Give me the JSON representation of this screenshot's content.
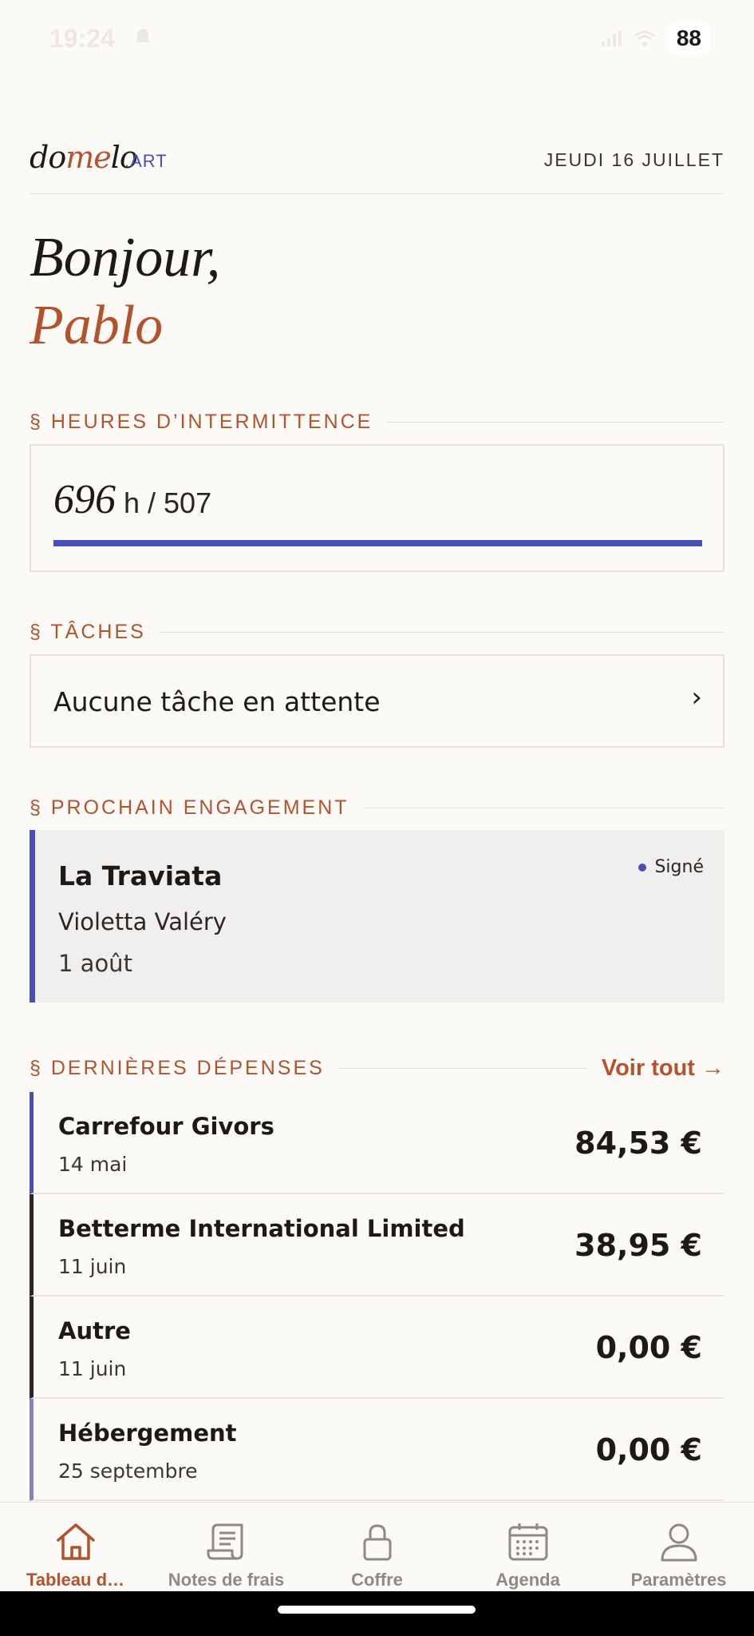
{
  "status_bar": {
    "time": "19:24",
    "battery": "88"
  },
  "header": {
    "logo_prefix": "do",
    "logo_accent": "me",
    "logo_rest": "lo",
    "logo_suffix": ".ART",
    "date": "JEUDI 16 JUILLET"
  },
  "greeting": {
    "line1": "Bonjour,",
    "name": "Pablo"
  },
  "hours": {
    "section_title": "§ HEURES D’INTERMITTENCE",
    "value": "696",
    "unit_target": "h / 507",
    "progress_percent": 100
  },
  "tasks": {
    "section_title": "§ TÂCHES",
    "empty_label": "Aucune tâche en attente",
    "chevron": "›"
  },
  "engagement": {
    "section_title": "§ PROCHAIN ENGAGEMENT",
    "title": "La Traviata",
    "role": "Violetta Valéry",
    "date": "1 août",
    "status": "Signé"
  },
  "expenses": {
    "section_title": "§ DERNIÈRES DÉPENSES",
    "see_all": "Voir tout →",
    "items": [
      {
        "name": "Carrefour Givors",
        "date": "14 mai",
        "amount": "84,53 €",
        "accent": "#4A4FB8"
      },
      {
        "name": "Betterme International Limited",
        "date": "11 juin",
        "amount": "38,95 €",
        "accent": "#2A2623"
      },
      {
        "name": "Autre",
        "date": "11 juin",
        "amount": "0,00 €",
        "accent": "#2A2623"
      },
      {
        "name": "Hébergement",
        "date": "25 septembre",
        "amount": "0,00 €",
        "accent": "#8A7EC2"
      }
    ]
  },
  "nav": {
    "items": [
      {
        "label": "Tableau d…",
        "icon": "home-icon",
        "active": true
      },
      {
        "label": "Notes de frais",
        "icon": "receipt-icon",
        "active": false
      },
      {
        "label": "Coffre",
        "icon": "lock-icon",
        "active": false
      },
      {
        "label": "Agenda",
        "icon": "calendar-icon",
        "active": false
      },
      {
        "label": "Paramètres",
        "icon": "user-icon",
        "active": false
      }
    ]
  },
  "colors": {
    "accent_terracotta": "#B2532E",
    "accent_indigo": "#4A4FB8",
    "background": "#FCFAF6"
  }
}
